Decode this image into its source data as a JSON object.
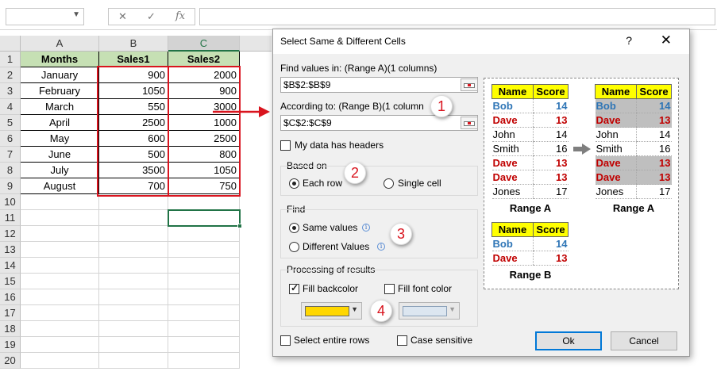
{
  "formula_bar": {
    "name_box": "",
    "cancel_glyph": "✕",
    "enter_glyph": "✓",
    "fx_glyph": "fx",
    "formula": ""
  },
  "sheet": {
    "columns": [
      "A",
      "B",
      "C"
    ],
    "rows": [
      "1",
      "2",
      "3",
      "4",
      "5",
      "6",
      "7",
      "8",
      "9",
      "10",
      "11",
      "12",
      "13",
      "14",
      "15",
      "16",
      "17",
      "18",
      "19",
      "20"
    ],
    "headers": [
      "Months",
      "Sales1",
      "Sales2"
    ],
    "data": [
      [
        "January",
        "900",
        "2000"
      ],
      [
        "February",
        "1050",
        "900"
      ],
      [
        "March",
        "550",
        "3000"
      ],
      [
        "April",
        "2500",
        "1000"
      ],
      [
        "May",
        "600",
        "2500"
      ],
      [
        "June",
        "500",
        "800"
      ],
      [
        "July",
        "3500",
        "1050"
      ],
      [
        "August",
        "700",
        "750"
      ]
    ],
    "header_fill": "#c6e0b4",
    "highlight_color": "#d9141e"
  },
  "dialog": {
    "title": "Select Same & Different Cells",
    "help": "?",
    "close": "✕",
    "find_values_label": "Find values in: (Range A)(1 columns)",
    "range_a": "$B$2:$B$9",
    "according_label": "According to: (Range B)(1 column",
    "range_b": "$C$2:$C$9",
    "headers_label": "My data has headers",
    "based_on": {
      "title": "Based on",
      "each_row": "Each row",
      "single_cell": "Single cell"
    },
    "find": {
      "title": "Find",
      "same": "Same values",
      "different": "Different Values"
    },
    "processing": {
      "title": "Processing of results",
      "fill_backcolor": "Fill backcolor",
      "fill_font_color": "Fill font color",
      "back_color": "#ffd700",
      "font_color": "#dce6f0"
    },
    "select_entire_rows": "Select entire rows",
    "case_sensitive": "Case sensitive",
    "ok": "Ok",
    "cancel": "Cancel",
    "steps": [
      "1",
      "2",
      "3",
      "4"
    ]
  },
  "preview": {
    "col_name": "Name",
    "col_score": "Score",
    "range_a_rows": [
      [
        "Bob",
        "14"
      ],
      [
        "Dave",
        "13"
      ],
      [
        "John",
        "14"
      ],
      [
        "Smith",
        "16"
      ],
      [
        "Dave",
        "13"
      ],
      [
        "Dave",
        "13"
      ],
      [
        "Jones",
        "17"
      ]
    ],
    "range_b_rows": [
      [
        "Bob",
        "14"
      ],
      [
        "Dave",
        "13"
      ]
    ],
    "caption_a": "Range A",
    "caption_b": "Range B",
    "caption_result": "Range A"
  }
}
